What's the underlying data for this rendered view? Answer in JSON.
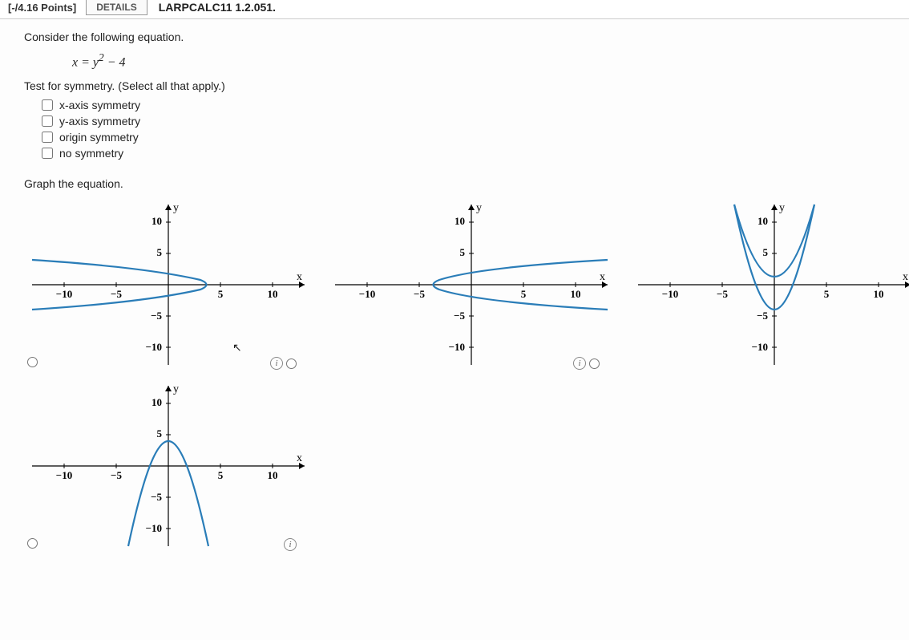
{
  "header": {
    "points": "[-/4.16 Points]",
    "details": "DETAILS",
    "reference": "LARPCALC11 1.2.051."
  },
  "problem": {
    "prompt": "Consider the following equation.",
    "equation_lhs": "x",
    "equation_eq": " = ",
    "equation_rhs_base": "y",
    "equation_rhs_exp": "2",
    "equation_rhs_tail": " − 4",
    "instruction": "Test for symmetry. (Select all that apply.)",
    "options": [
      "x-axis symmetry",
      "y-axis symmetry",
      "origin symmetry",
      "no symmetry"
    ],
    "graph_prompt": "Graph the equation."
  },
  "axis": {
    "y_label": "y",
    "x_label": "x",
    "ticks": {
      "n10": "−10",
      "n5": "−5",
      "p5": "5",
      "p10": "10"
    }
  },
  "chart_data": [
    {
      "type": "line",
      "description": "sideways parabola opening left, vertex right of origin",
      "xlabel": "x",
      "ylabel": "y",
      "xlim": [
        -12,
        12
      ],
      "ylim": [
        -12,
        12
      ],
      "x_ticks": [
        -10,
        -5,
        5,
        10
      ],
      "y_ticks": [
        -10,
        -5,
        5,
        10
      ],
      "series": [
        {
          "name": "curve",
          "x": [
            -12,
            -8,
            -4,
            0,
            4,
            0,
            -4,
            -8,
            -12
          ],
          "y": [
            4,
            3.46,
            2.83,
            2,
            0,
            -2,
            -2.83,
            -3.46,
            -4
          ]
        }
      ]
    },
    {
      "type": "line",
      "description": "sideways parabola x = y^2 - 4 opening right",
      "xlabel": "x",
      "ylabel": "y",
      "xlim": [
        -12,
        12
      ],
      "ylim": [
        -12,
        12
      ],
      "x_ticks": [
        -10,
        -5,
        5,
        10
      ],
      "y_ticks": [
        -10,
        -5,
        5,
        10
      ],
      "series": [
        {
          "name": "curve",
          "x": [
            12,
            5,
            0,
            -3,
            -4,
            -3,
            0,
            5,
            12
          ],
          "y": [
            4,
            3,
            2,
            1,
            0,
            -1,
            -2,
            -3,
            -4
          ]
        }
      ]
    },
    {
      "type": "line",
      "description": "upward parabola y = x^2 - 4",
      "xlabel": "x",
      "ylabel": "y",
      "xlim": [
        -12,
        12
      ],
      "ylim": [
        -12,
        12
      ],
      "x_ticks": [
        -10,
        -5,
        5,
        10
      ],
      "y_ticks": [
        -10,
        -5,
        5,
        10
      ],
      "series": [
        {
          "name": "curve",
          "x": [
            -4,
            -3,
            -2,
            -1,
            0,
            1,
            2,
            3,
            4
          ],
          "y": [
            12,
            5,
            0,
            -3,
            -4,
            -3,
            0,
            5,
            12
          ]
        }
      ]
    },
    {
      "type": "line",
      "description": "downward parabola y = -x^2 + 4",
      "xlabel": "x",
      "ylabel": "y",
      "xlim": [
        -12,
        12
      ],
      "ylim": [
        -12,
        12
      ],
      "x_ticks": [
        -10,
        -5,
        5,
        10
      ],
      "y_ticks": [
        -10,
        -5,
        5,
        10
      ],
      "series": [
        {
          "name": "curve",
          "x": [
            -4,
            -3,
            -2,
            -1,
            0,
            1,
            2,
            3,
            4
          ],
          "y": [
            -12,
            -5,
            0,
            3,
            4,
            3,
            0,
            -5,
            -12
          ]
        }
      ]
    }
  ],
  "info_icon": "i"
}
